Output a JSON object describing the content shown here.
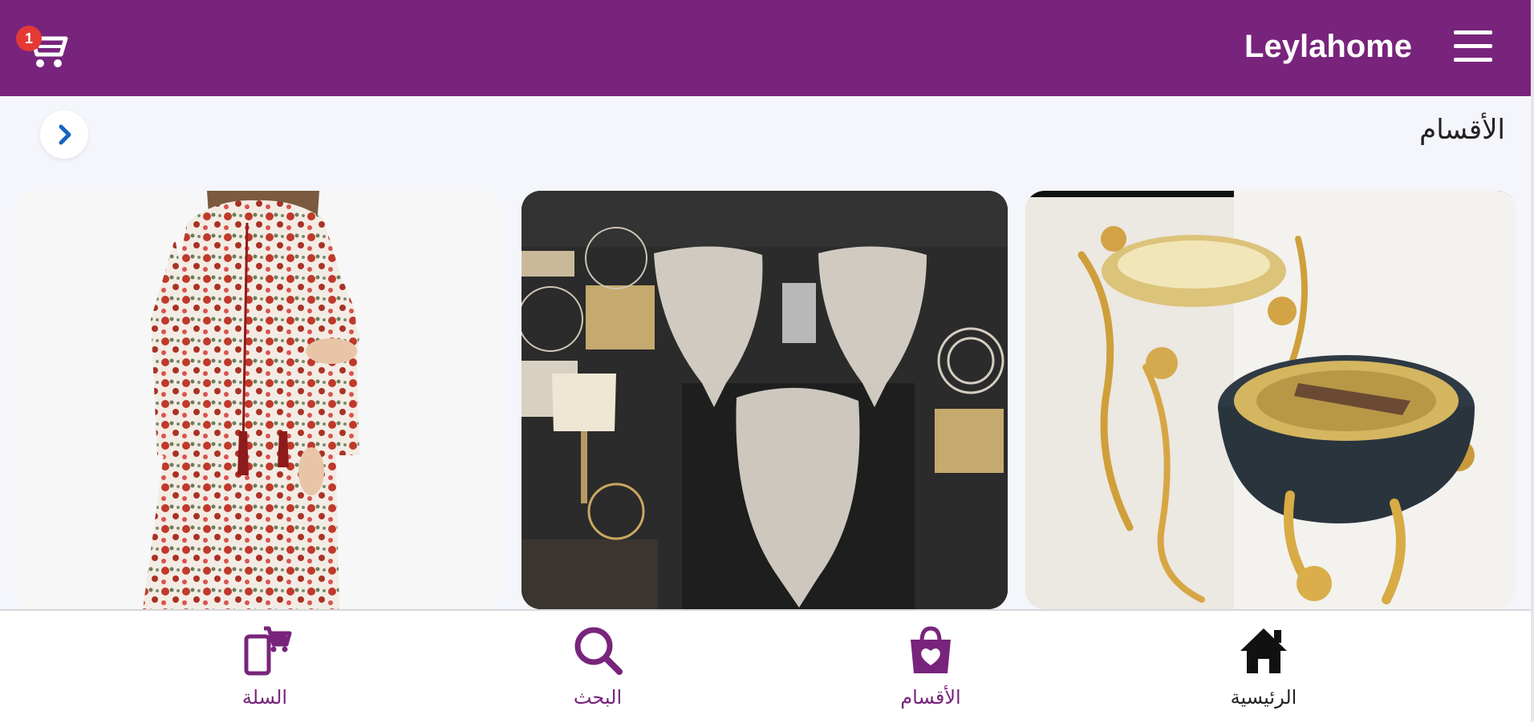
{
  "header": {
    "brand": "Leylahome",
    "cart_count": "1",
    "cart_icon": "shopping-cart-icon",
    "menu_icon": "hamburger-menu-icon",
    "background": "#78247c"
  },
  "categories": {
    "title": "الأقسام",
    "arrow_icon": "chevron-right-icon",
    "arrow_color": "#1565c0"
  },
  "cards": [
    {
      "name": "product-card-dress",
      "image": "woman-in-floral-dress"
    },
    {
      "name": "product-card-lace",
      "image": "lace-table-runners-on-dark-wall"
    },
    {
      "name": "product-card-incense",
      "image": "gold-marble-incense-burner"
    }
  ],
  "bottom_nav": {
    "items": [
      {
        "label": "الرئيسية",
        "icon": "home-icon",
        "color": "#111111"
      },
      {
        "label": "الأقسام",
        "icon": "shopping-bag-heart-icon",
        "color": "#78247c"
      },
      {
        "label": "البحث",
        "icon": "search-icon",
        "color": "#78247c"
      },
      {
        "label": "السلة",
        "icon": "cart-phone-icon",
        "color": "#78247c"
      }
    ]
  }
}
